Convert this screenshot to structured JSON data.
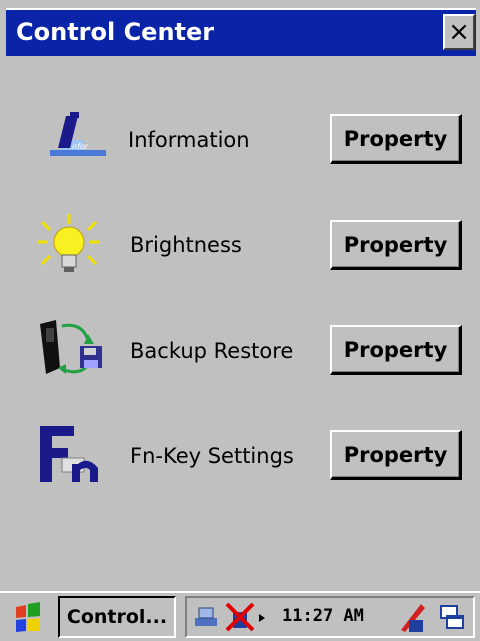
{
  "window": {
    "title": "Control Center",
    "close_label": "×"
  },
  "items": [
    {
      "label": "Information",
      "icon": "information-icon",
      "button": "Property"
    },
    {
      "label": "Brightness",
      "icon": "brightness-icon",
      "button": "Property"
    },
    {
      "label": "Backup Restore",
      "icon": "backup-restore-icon",
      "button": "Property"
    },
    {
      "label": "Fn-Key Settings",
      "icon": "fn-key-icon",
      "button": "Property"
    }
  ],
  "taskbar": {
    "task_label": "Control...",
    "clock": "11:27 AM"
  },
  "colors": {
    "titlebar": "#0a24a8",
    "background": "#c0c0c0"
  }
}
